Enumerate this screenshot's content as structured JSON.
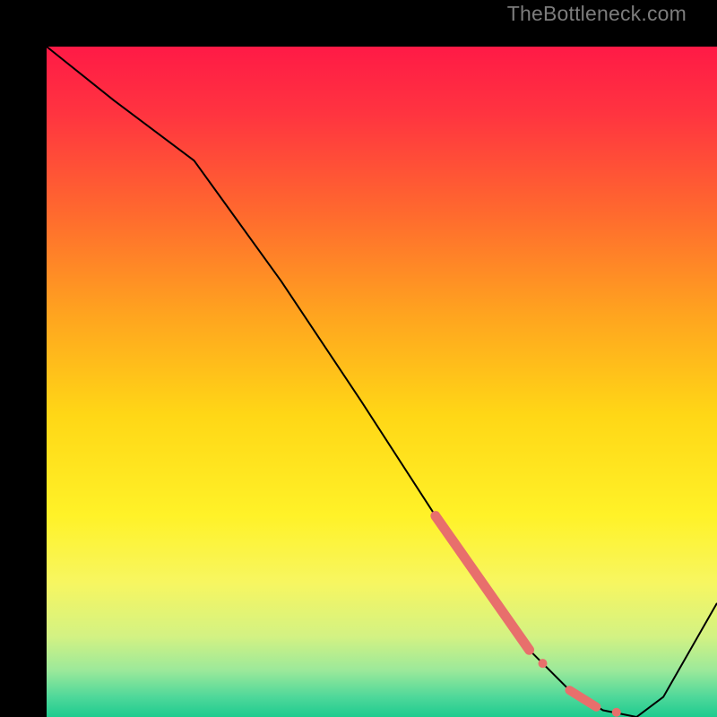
{
  "watermark": "TheBottleneck.com",
  "chart_data": {
    "type": "line",
    "title": "",
    "xlabel": "",
    "ylabel": "",
    "xlim": [
      0,
      100
    ],
    "ylim": [
      0,
      100
    ],
    "grid": false,
    "series": [
      {
        "name": "bottleneck-curve",
        "x": [
          0,
          10,
          22,
          35,
          47,
          58,
          66,
          72,
          78,
          83,
          88,
          92,
          100
        ],
        "y": [
          100,
          92,
          83,
          65,
          47,
          30,
          18,
          10,
          4,
          1,
          0,
          3,
          17
        ],
        "color": "#000000",
        "stroke_width": 2
      }
    ],
    "highlights": [
      {
        "name": "highlight-segment-main",
        "x": [
          58,
          72
        ],
        "y": [
          30,
          10
        ],
        "color": "#e86f6c",
        "stroke_width": 11
      },
      {
        "name": "highlight-dot-1",
        "cx": 74,
        "cy": 8,
        "color": "#e86f6c",
        "r": 5
      },
      {
        "name": "highlight-segment-short",
        "x": [
          78,
          82
        ],
        "y": [
          4,
          1.5
        ],
        "color": "#e86f6c",
        "stroke_width": 10
      },
      {
        "name": "highlight-dot-2",
        "cx": 85,
        "cy": 0.7,
        "color": "#e86f6c",
        "r": 5
      }
    ],
    "background_gradient": {
      "stops": [
        {
          "offset": 0.0,
          "color": "#ff1a46"
        },
        {
          "offset": 0.1,
          "color": "#ff3440"
        },
        {
          "offset": 0.25,
          "color": "#ff6a2e"
        },
        {
          "offset": 0.4,
          "color": "#ffa41f"
        },
        {
          "offset": 0.55,
          "color": "#ffd716"
        },
        {
          "offset": 0.7,
          "color": "#fff228"
        },
        {
          "offset": 0.8,
          "color": "#f7f661"
        },
        {
          "offset": 0.88,
          "color": "#d3f283"
        },
        {
          "offset": 0.93,
          "color": "#9ce99a"
        },
        {
          "offset": 0.97,
          "color": "#4fd89a"
        },
        {
          "offset": 1.0,
          "color": "#1ecb8f"
        }
      ]
    }
  }
}
